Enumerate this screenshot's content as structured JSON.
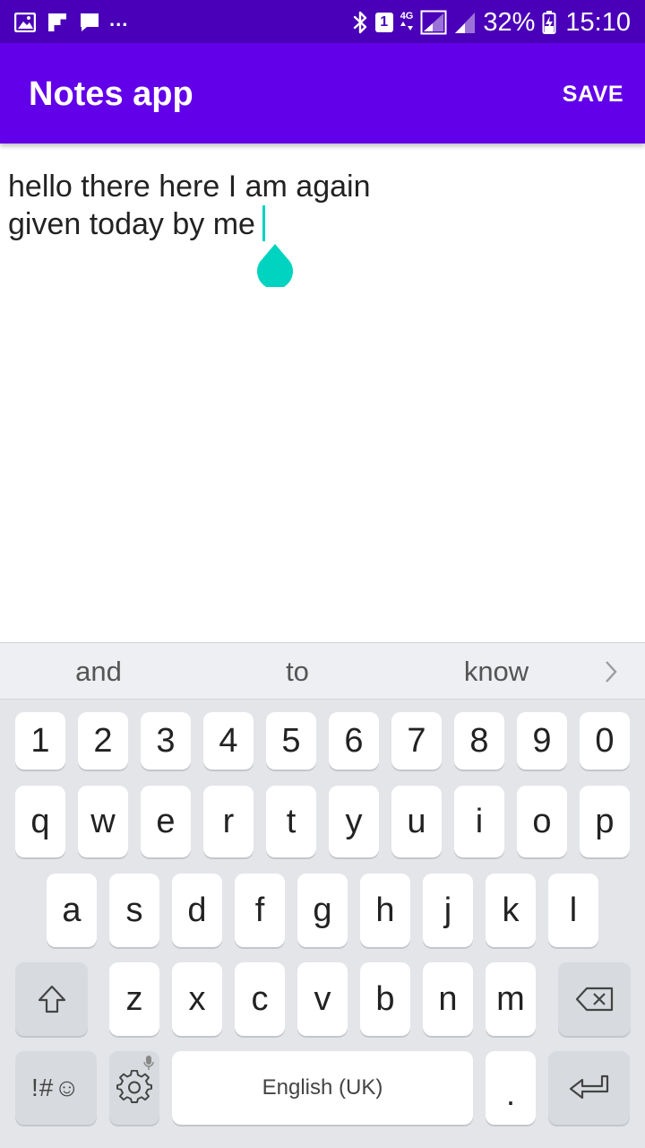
{
  "status_bar": {
    "left_icons": [
      "image-icon",
      "flipboard-icon",
      "message-icon"
    ],
    "overflow": "...",
    "sim_slot": "1",
    "network_type": "4G",
    "battery_percent": "32%",
    "time": "15:10",
    "bg_color": "#4a00b8"
  },
  "app_bar": {
    "title": "Notes app",
    "save_label": "SAVE",
    "bg_color": "#6200ea"
  },
  "editor": {
    "lines": [
      "hello there here I am again",
      "given today by me"
    ],
    "cursor_color": "#00d4c0"
  },
  "keyboard": {
    "suggestions": [
      "and",
      "to",
      "know"
    ],
    "number_row": [
      "1",
      "2",
      "3",
      "4",
      "5",
      "6",
      "7",
      "8",
      "9",
      "0"
    ],
    "row1": [
      "q",
      "w",
      "e",
      "r",
      "t",
      "y",
      "u",
      "i",
      "o",
      "p"
    ],
    "row2": [
      "a",
      "s",
      "d",
      "f",
      "g",
      "h",
      "j",
      "k",
      "l"
    ],
    "row3": [
      "z",
      "x",
      "c",
      "v",
      "b",
      "n",
      "m"
    ],
    "symbols_label": "!#☺",
    "space_label": "English (UK)",
    "period_label": ".",
    "bg_color": "#e3e5e9"
  }
}
